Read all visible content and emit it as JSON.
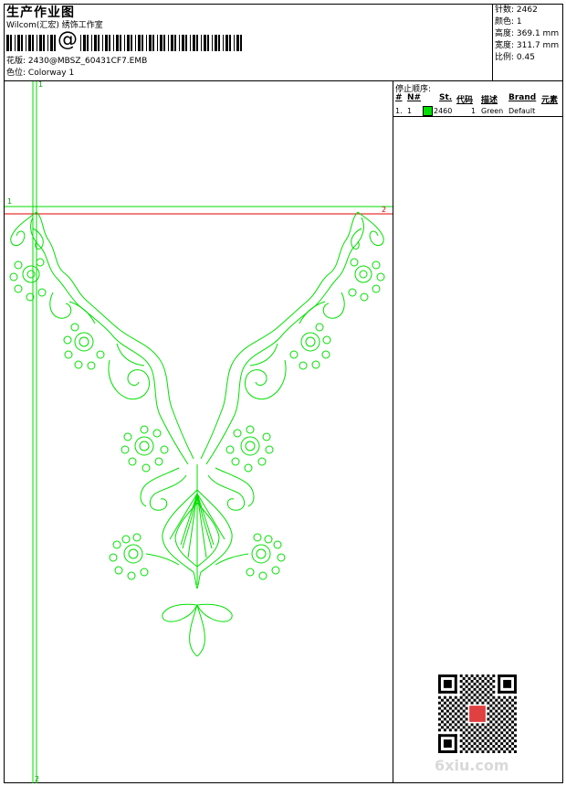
{
  "header": {
    "title": "生产作业图",
    "company": "Wilcom(汇宏) 绣饰工作室",
    "at_symbol": "@",
    "design_label": "花版",
    "design_file": "2430@MBSZ_60431CF7.EMB",
    "colorway_label": "色位",
    "colorway": "Colorway 1"
  },
  "stats": {
    "stitches_label": "针数",
    "stitches": "2462",
    "colors_label": "颜色",
    "colors": "1",
    "height_label": "高度",
    "height": "369.1 mm",
    "width_label": "宽度",
    "width": "311.7 mm",
    "ratio_label": "比例",
    "ratio": "0.45"
  },
  "stop_sequence": {
    "title": "停止顺序:",
    "columns": [
      "#",
      "N#",
      "St.",
      "代码",
      "描述",
      "Brand",
      "元素"
    ],
    "rows": [
      {
        "index": "1.",
        "needle": "1",
        "stitches": "2460",
        "code": "1",
        "description": "Green",
        "brand": "Default",
        "swatch": "#00e000"
      }
    ]
  },
  "guides": {
    "top_v_marker": "1",
    "bottom_v_marker": "2",
    "left_h_marker": "1",
    "right_h_marker": "2"
  },
  "watermark": {
    "logo": "6xiu.com"
  }
}
